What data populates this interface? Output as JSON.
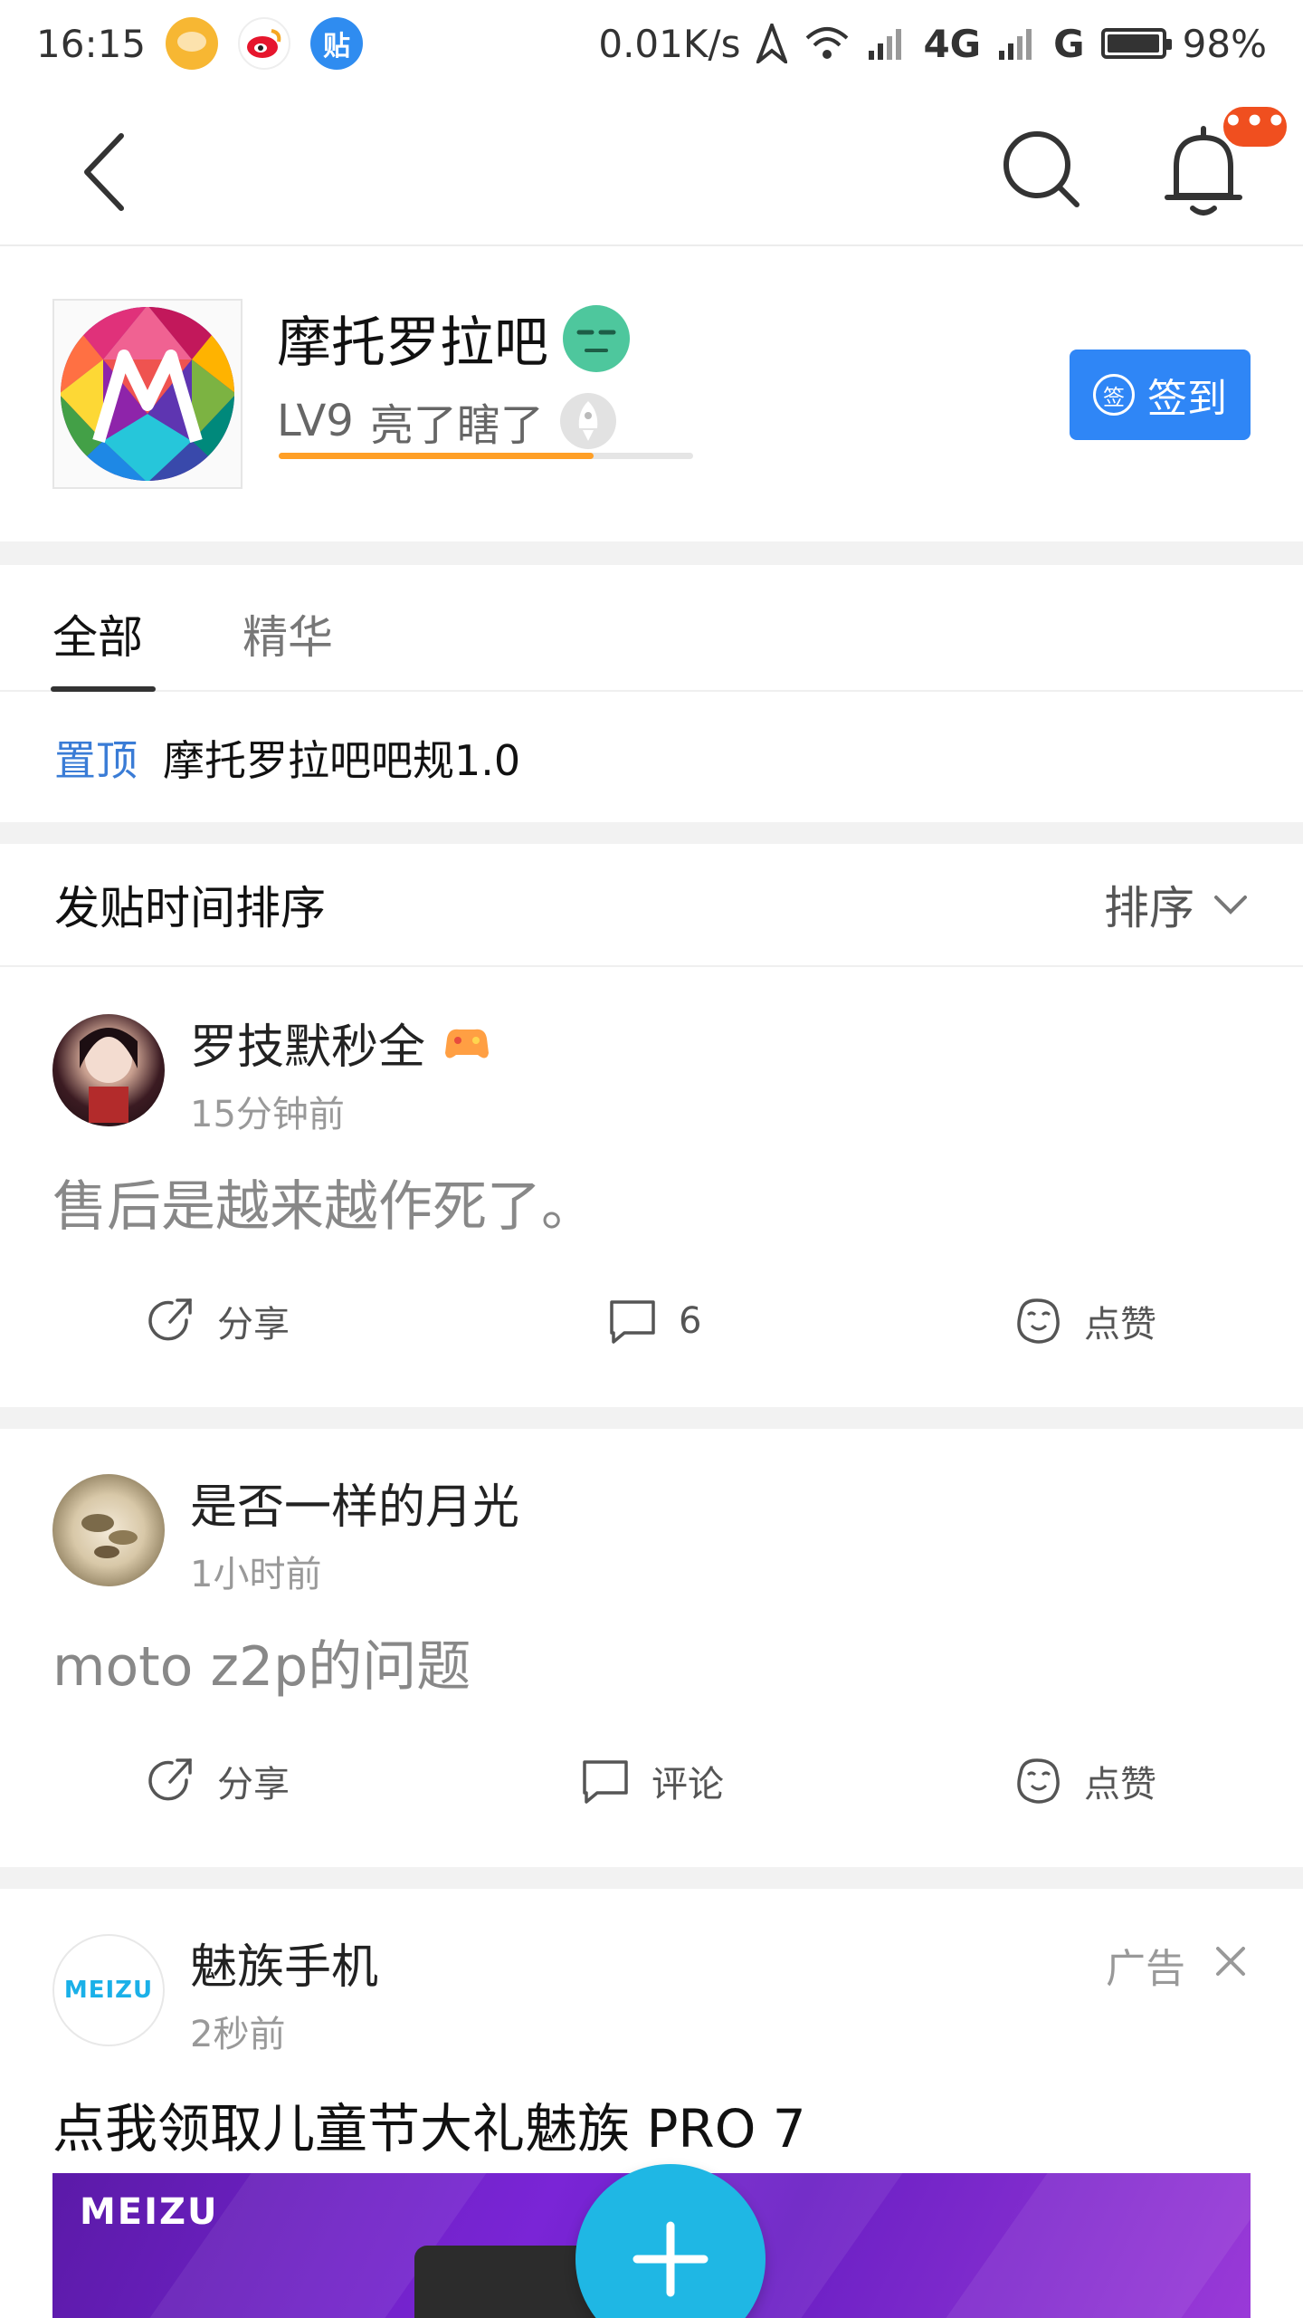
{
  "status_bar": {
    "time": "16:15",
    "notif_icons": [
      "chat-bubble-icon",
      "weibo-icon",
      "tieba-icon"
    ],
    "tieba_icon_label": "贴",
    "net_speed": "0.01K/s",
    "network_4g": "4G",
    "network_g": "G",
    "battery": "98%"
  },
  "top_nav": {
    "notification_badge": "•••"
  },
  "forum": {
    "name": "摩托罗拉吧",
    "level": "LV9",
    "level_title": "亮了瞎了",
    "level_progress_percent": 76,
    "signin_label": "签到",
    "signin_icon_label": "签"
  },
  "tabs": [
    {
      "label": "全部",
      "active": true
    },
    {
      "label": "精华",
      "active": false
    }
  ],
  "pinned": {
    "tag": "置顶",
    "title": "摩托罗拉吧吧规1.0"
  },
  "sort_bar": {
    "label": "发贴时间排序",
    "sort_button": "排序"
  },
  "posts": [
    {
      "username": "罗技默秒全",
      "time": "15分钟前",
      "text": "售后是越来越作死了。",
      "share_label": "分享",
      "comment_label": "6",
      "like_label": "点赞"
    },
    {
      "username": "是否一样的月光",
      "time": "1小时前",
      "text": "moto z2p的问题",
      "share_label": "分享",
      "comment_label": "评论",
      "like_label": "点赞"
    }
  ],
  "ad": {
    "advertiser": "魅族手机",
    "avatar_text": "MEIZU",
    "time": "2秒前",
    "ad_label": "广告",
    "title": "点我领取儿童节大礼魅族  PRO  7",
    "banner_brand": "MEIZU"
  },
  "colors": {
    "accent_blue": "#2f86f6",
    "pinned_blue": "#3a7cd6",
    "progress_orange": "#ff9f26",
    "fab_cyan": "#1fb7e4",
    "badge_red": "#f04f1f"
  }
}
